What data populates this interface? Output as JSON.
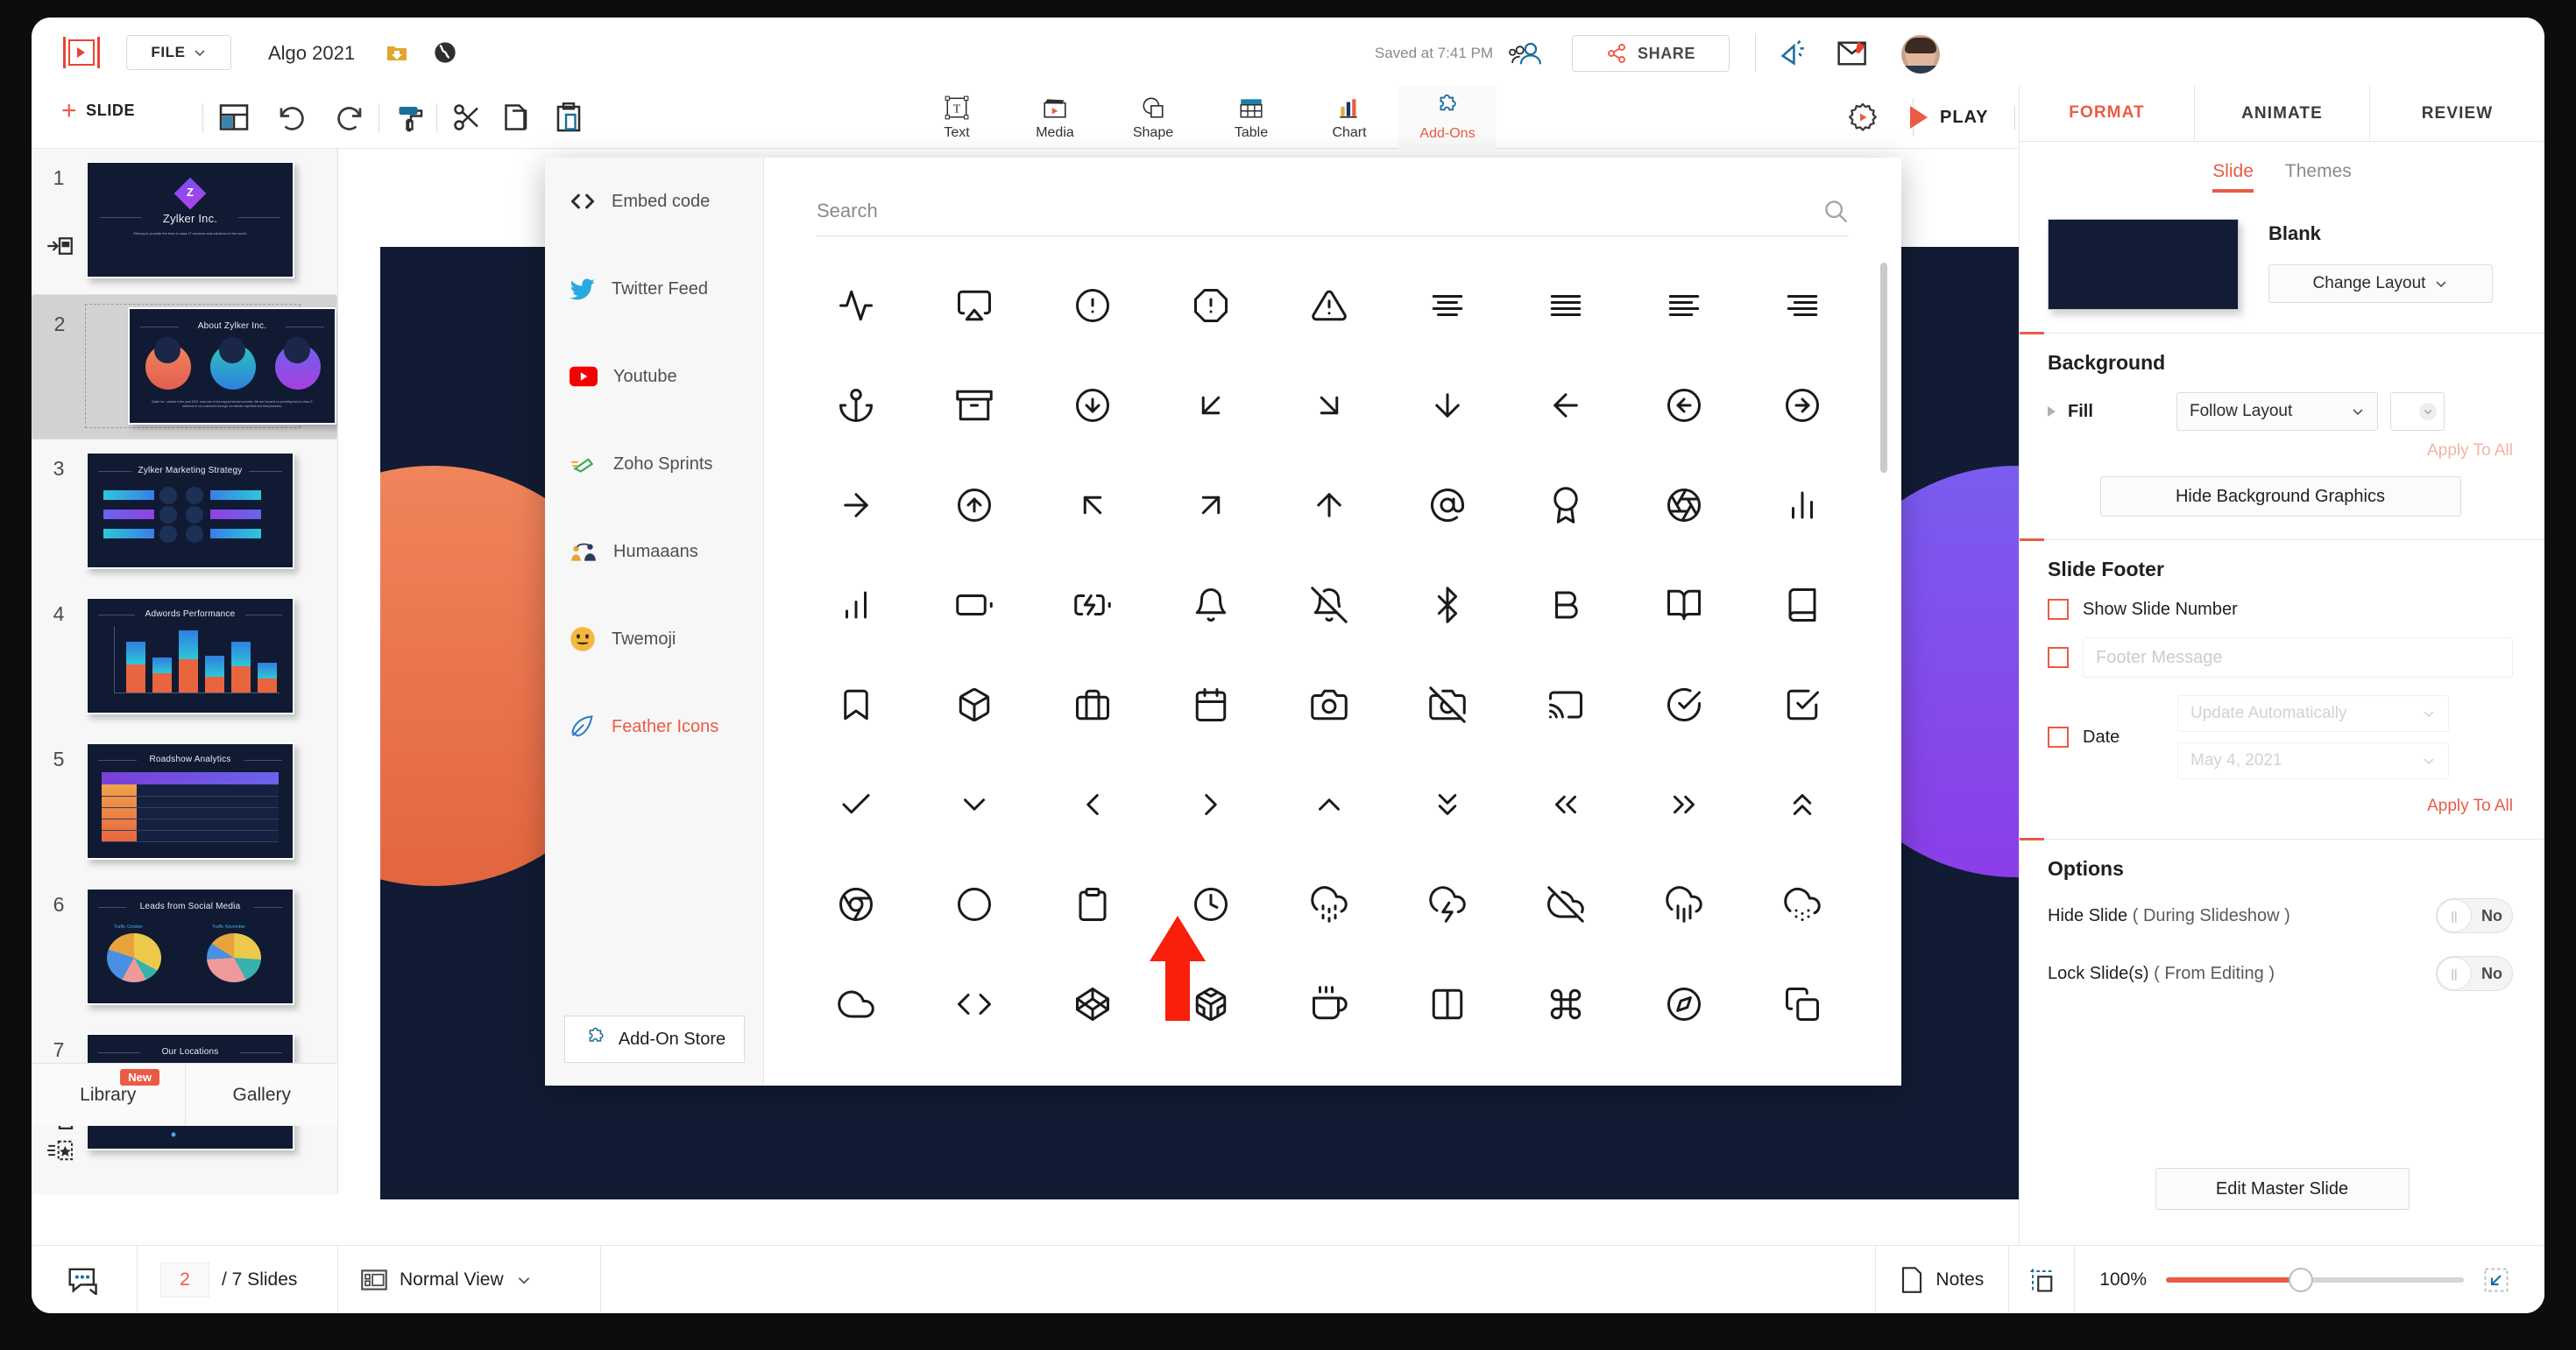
{
  "app": {
    "file_menu": "FILE",
    "document_title": "Algo 2021",
    "saved_status": "Saved at 7:41 PM",
    "share_label": "SHARE",
    "add_slide_label": "SLIDE",
    "play_label": "PLAY"
  },
  "center_tools": [
    {
      "label": "Text",
      "icon": "text-box-icon",
      "active": false
    },
    {
      "label": "Media",
      "icon": "clapperboard-icon",
      "active": false
    },
    {
      "label": "Shape",
      "icon": "shapes-icon",
      "active": false
    },
    {
      "label": "Table",
      "icon": "table-icon",
      "active": false
    },
    {
      "label": "Chart",
      "icon": "bar-chart-icon",
      "active": false
    },
    {
      "label": "Add-Ons",
      "icon": "puzzle-piece-icon",
      "active": true
    }
  ],
  "right_panel": {
    "tabs": [
      {
        "label": "FORMAT",
        "active": true
      },
      {
        "label": "ANIMATE",
        "active": false
      },
      {
        "label": "REVIEW",
        "active": false
      }
    ],
    "subtabs": [
      {
        "label": "Slide",
        "active": true
      },
      {
        "label": "Themes",
        "active": false
      }
    ],
    "layout_name": "Blank",
    "change_layout": "Change Layout",
    "background": {
      "heading": "Background",
      "fill_label": "Fill",
      "fill_value": "Follow Layout",
      "apply_to_all": "Apply To All",
      "hide_background_graphics": "Hide Background Graphics"
    },
    "slide_footer": {
      "heading": "Slide Footer",
      "show_slide_number": "Show Slide Number",
      "footer_placeholder": "Footer Message",
      "date_label": "Date",
      "date_mode": "Update Automatically",
      "date_value": "May 4, 2021",
      "apply_to_all": "Apply To All"
    },
    "options": {
      "heading": "Options",
      "hide_slide_label": "Hide Slide",
      "hide_slide_sub": "( During Slideshow )",
      "hide_slide_value": "No",
      "lock_slide_label": "Lock Slide(s)",
      "lock_slide_sub": "( From Editing )",
      "lock_slide_value": "No"
    },
    "edit_master_slide": "Edit Master Slide"
  },
  "slides": [
    {
      "number": "1",
      "title": "Zylker Inc.",
      "subtitle": "Striving to provide the best in class IT services and solutions to the world.",
      "kind": "title",
      "selected": false
    },
    {
      "number": "2",
      "title": "About Zylker Inc.",
      "subtitle": "Zylker Inc., started in the year 2000, soon one of the support service provider. We are focused on providing best in class IT solutions to our customers through our domain expertise and best practices.",
      "kind": "circles",
      "selected": true
    },
    {
      "number": "3",
      "title": "Zylker Marketing Strategy",
      "subtitle": "",
      "kind": "strategy",
      "selected": false
    },
    {
      "number": "4",
      "title": "Adwords Performance",
      "subtitle": "",
      "kind": "bars",
      "selected": false
    },
    {
      "number": "5",
      "title": "Roadshow Analytics",
      "subtitle": "",
      "kind": "table",
      "selected": false
    },
    {
      "number": "6",
      "title": "Leads from Social Media",
      "subtitle": "",
      "kind": "pies",
      "selected": false
    },
    {
      "number": "7",
      "title": "Our Locations",
      "subtitle": "",
      "kind": "map",
      "selected": false
    }
  ],
  "left_panel_tabs": [
    {
      "label": "Library",
      "badge": "New"
    },
    {
      "label": "Gallery",
      "badge": ""
    }
  ],
  "canvas": {
    "caption": "class IT solutions to our customers through our domain expertise and best practices."
  },
  "bottom_bar": {
    "current_slide": "2",
    "slide_count": "/ 7 Slides",
    "view_mode": "Normal View",
    "notes": "Notes",
    "zoom": "100%"
  },
  "addons_popup": {
    "search_placeholder": "Search",
    "store_button": "Add-On Store",
    "items": [
      {
        "label": "Embed code",
        "icon": "code-brackets-icon",
        "active": false
      },
      {
        "label": "Twitter Feed",
        "icon": "twitter-bird-icon",
        "active": false
      },
      {
        "label": "Youtube",
        "icon": "youtube-icon",
        "active": false
      },
      {
        "label": "Zoho Sprints",
        "icon": "zoho-sprints-icon",
        "active": false
      },
      {
        "label": "Humaaans",
        "icon": "humaaans-icon",
        "active": false
      },
      {
        "label": "Twemoji",
        "icon": "twemoji-smiley-icon",
        "active": false
      },
      {
        "label": "Feather Icons",
        "icon": "feather-quill-icon",
        "active": true
      }
    ],
    "icon_grid": [
      "activity",
      "airplay",
      "alert-circle",
      "alert-octagon",
      "alert-triangle",
      "align-center",
      "align-justify",
      "align-left",
      "align-right",
      "anchor",
      "archive",
      "arrow-down-circle",
      "arrow-down-left",
      "arrow-down-right",
      "arrow-down",
      "arrow-left",
      "arrow-left-circle",
      "arrow-right-circle",
      "arrow-right",
      "arrow-up-circle",
      "arrow-up-left",
      "arrow-up-right",
      "arrow-up",
      "at-sign",
      "award",
      "aperture",
      "bar-chart-2",
      "bar-chart",
      "battery",
      "battery-charging",
      "bell",
      "bell-off",
      "bluetooth",
      "bold",
      "book-open",
      "book",
      "bookmark",
      "box",
      "briefcase",
      "calendar",
      "camera",
      "camera-off",
      "cast",
      "check-circle",
      "check-square",
      "check",
      "chevron-down",
      "chevron-left",
      "chevron-right",
      "chevron-up",
      "chevrons-down",
      "chevrons-left",
      "chevrons-right",
      "chevrons-up",
      "chrome",
      "circle",
      "clipboard",
      "clock",
      "cloud-drizzle",
      "cloud-lightning",
      "cloud-off",
      "cloud-rain",
      "cloud-snow",
      "cloud",
      "code",
      "codepen",
      "codesandbox",
      "coffee",
      "columns",
      "command",
      "compass",
      "copy"
    ]
  }
}
